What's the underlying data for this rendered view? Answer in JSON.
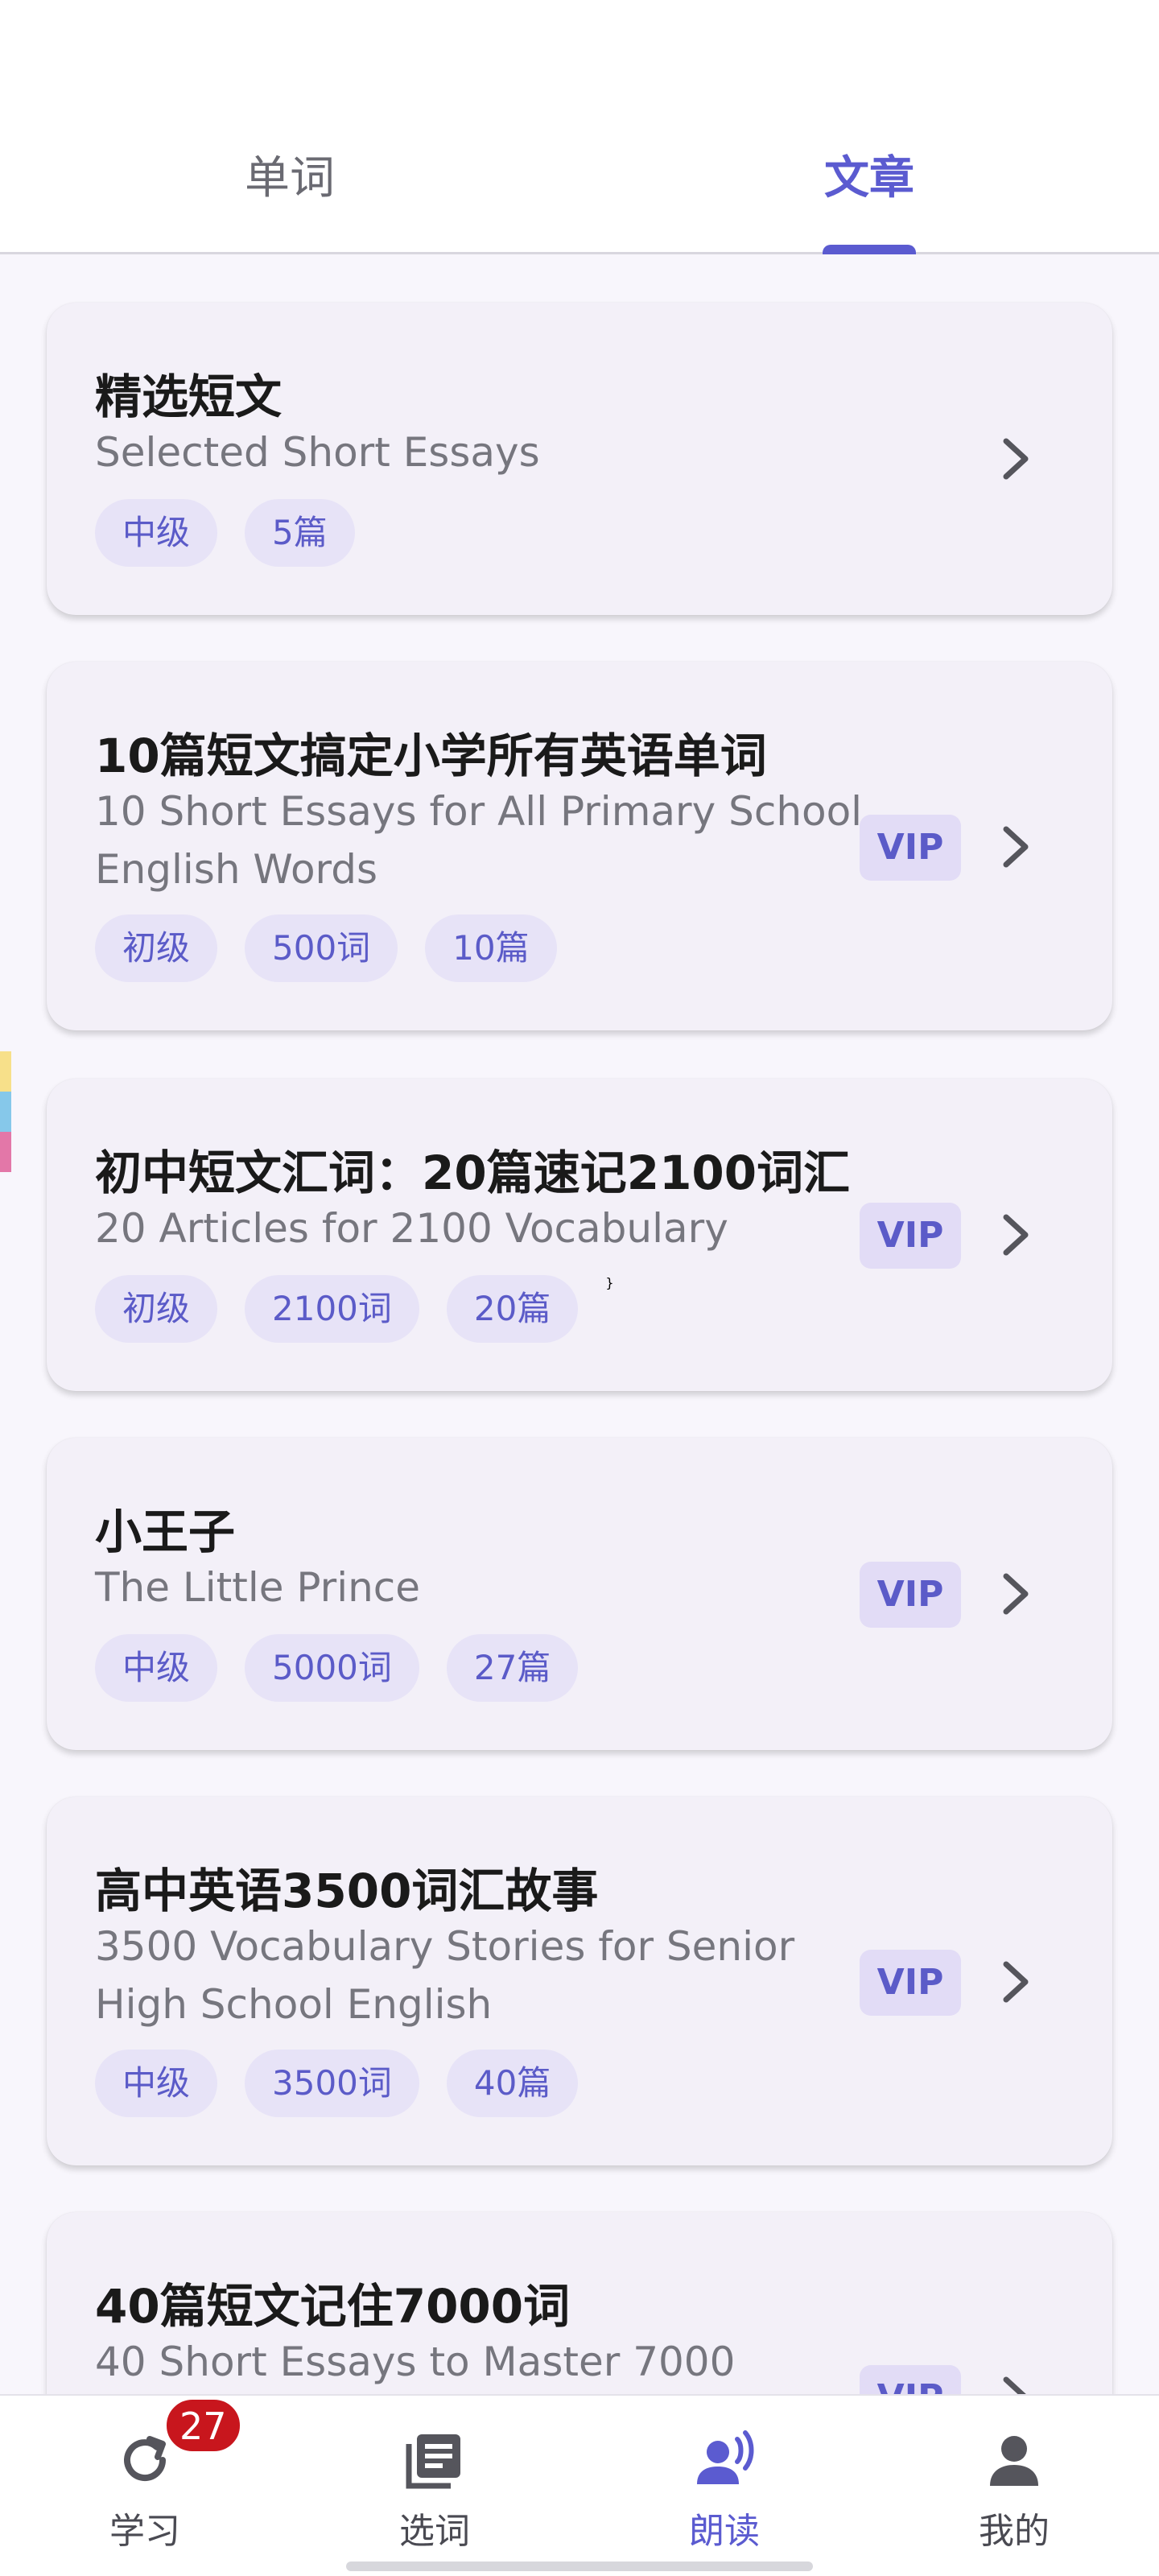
{
  "tabs": {
    "words": "单词",
    "articles": "文章",
    "active": "articles"
  },
  "articles": [
    {
      "title": "精选短文",
      "subtitle": "Selected Short Essays",
      "tags": [
        "中级",
        "5篇"
      ],
      "vip": ""
    },
    {
      "title": "10篇短文搞定小学所有英语单词",
      "subtitle": "10 Short Essays for All Primary School English Words",
      "tags": [
        "初级",
        "500词",
        "10篇"
      ],
      "vip": "VIP"
    },
    {
      "title": "初中短文汇词：20篇速记2100词汇",
      "subtitle": "20 Articles for 2100 Vocabulary",
      "tags": [
        "初级",
        "2100词",
        "20篇"
      ],
      "vip": "VIP"
    },
    {
      "title": "小王子",
      "subtitle": "The Little Prince",
      "tags": [
        "中级",
        "5000词",
        "27篇"
      ],
      "vip": "VIP"
    },
    {
      "title": "高中英语3500词汇故事",
      "subtitle": "3500 Vocabulary Stories for Senior High School English",
      "tags": [
        "中级",
        "3500词",
        "40篇"
      ],
      "vip": "VIP"
    },
    {
      "title": "40篇短文记住7000词",
      "subtitle": "40 Short Essays to Master 7000",
      "tags": [],
      "vip": "VIP"
    }
  ],
  "bottom_nav": {
    "items": [
      {
        "label": "学习",
        "icon": "refresh-icon",
        "badge": "27"
      },
      {
        "label": "选词",
        "icon": "book-list-icon"
      },
      {
        "label": "朗读",
        "icon": "speaking-person-icon",
        "active": true
      },
      {
        "label": "我的",
        "icon": "person-icon"
      }
    ]
  },
  "colors": {
    "accent": "#5b5bd0",
    "card_bg": "#f3f0f8",
    "tag_bg": "#e7e3f7",
    "badge": "#c8161d"
  }
}
